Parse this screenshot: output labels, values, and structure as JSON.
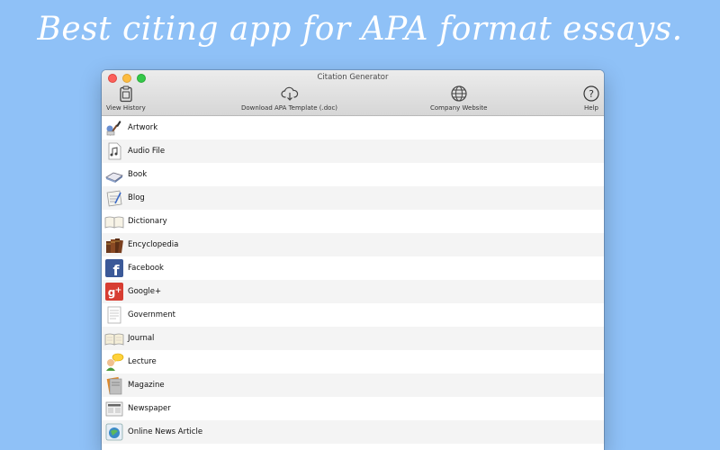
{
  "headline": "Best citing app for APA format essays.",
  "window": {
    "title": "Citation Generator",
    "toolbar": {
      "view_history": "View History",
      "download": "Download APA Template (.doc)",
      "company": "Company Website",
      "help": "Help"
    }
  },
  "list": [
    {
      "label": "Artwork",
      "icon": "artwork-icon"
    },
    {
      "label": "Audio File",
      "icon": "audio-file-icon"
    },
    {
      "label": "Book",
      "icon": "book-icon"
    },
    {
      "label": "Blog",
      "icon": "blog-icon"
    },
    {
      "label": "Dictionary",
      "icon": "dictionary-icon"
    },
    {
      "label": "Encyclopedia",
      "icon": "encyclopedia-icon"
    },
    {
      "label": "Facebook",
      "icon": "facebook-icon"
    },
    {
      "label": "Google+",
      "icon": "google-plus-icon"
    },
    {
      "label": "Government",
      "icon": "government-icon"
    },
    {
      "label": "Journal",
      "icon": "journal-icon"
    },
    {
      "label": "Lecture",
      "icon": "lecture-icon"
    },
    {
      "label": "Magazine",
      "icon": "magazine-icon"
    },
    {
      "label": "Newspaper",
      "icon": "newspaper-icon"
    },
    {
      "label": "Online News Article",
      "icon": "online-news-icon"
    }
  ]
}
